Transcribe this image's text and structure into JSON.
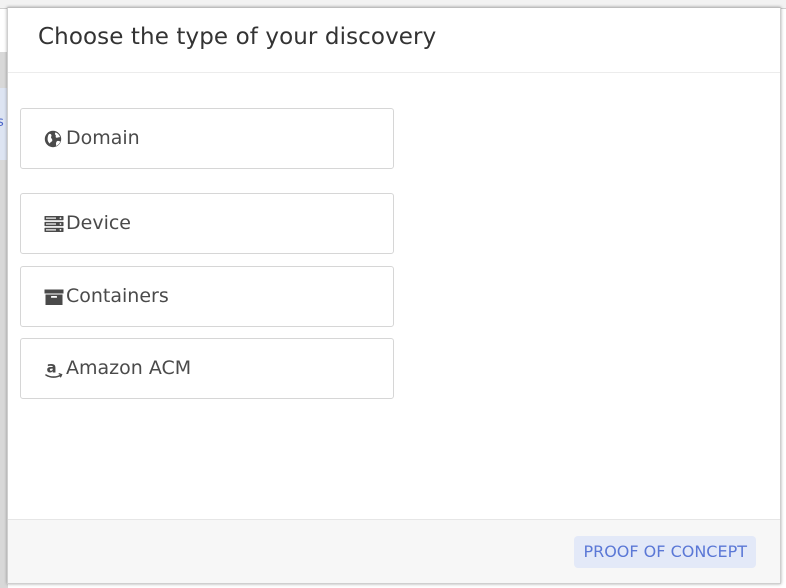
{
  "modal": {
    "title": "Choose the type of your discovery"
  },
  "options": [
    {
      "label": "Domain",
      "icon": "globe-icon"
    },
    {
      "label": "Device",
      "icon": "server-icon"
    },
    {
      "label": "Containers",
      "icon": "archive-box-icon"
    },
    {
      "label": "Amazon ACM",
      "icon": "amazon-icon"
    }
  ],
  "footer": {
    "badge": "PROOF OF CONCEPT"
  },
  "background": {
    "edge_glyph": "s"
  },
  "colors": {
    "badge_bg": "#e3e9f8",
    "badge_text": "#5b78d6",
    "icon": "#4a4a4a"
  }
}
